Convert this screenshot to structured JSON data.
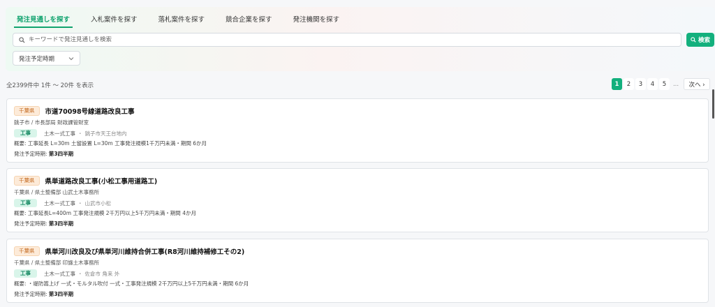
{
  "tabs": [
    {
      "label": "発注見通しを探す",
      "active": true
    },
    {
      "label": "入札案件を探す",
      "active": false
    },
    {
      "label": "落札案件を探す",
      "active": false
    },
    {
      "label": "競合企業を探す",
      "active": false
    },
    {
      "label": "発注機関を探す",
      "active": false
    }
  ],
  "search": {
    "placeholder": "キーワードで発注見通しを検索",
    "value": "",
    "button_label": "検索"
  },
  "filter": {
    "period_label": "発注予定時期"
  },
  "results": {
    "summary": "全2399件中 1件 〜 20件 を表示"
  },
  "pagination": {
    "pages": [
      "1",
      "2",
      "3",
      "4",
      "5"
    ],
    "current": "1",
    "ellipsis": "...",
    "next_label": "次へ ›"
  },
  "cards": [
    {
      "prefecture": "千葉県",
      "title": "市道70098号線道路改良工事",
      "org": "銚子市 / 市長部局 財政課管財室",
      "kind": "工事",
      "category": "土木一式工事",
      "location": "銚子市天王台地内",
      "summary": "概要: 工事延長 L=30m 土留設置 L=30m 工事発注規模1千万円未満・期間 6か月",
      "period_label": "発注予定時期:",
      "period_value": "第3四半期"
    },
    {
      "prefecture": "千葉県",
      "title": "県単道路改良工事(小松工事用道路工)",
      "org": "千葉県 / 県土整備部 山武土木事務所",
      "kind": "工事",
      "category": "土木一式工事",
      "location": "山武市小松",
      "summary": "概要: 工事延長L=400m 工事発注規模 2千万円以上5千万円未満・期間 4か月",
      "period_label": "発注予定時期:",
      "period_value": "第3四半期"
    },
    {
      "prefecture": "千葉県",
      "title": "県単河川改良及び県単河川維持合併工事(R8河川維持補修工その2)",
      "org": "千葉県 / 県土整備部 印旛土木事務所",
      "kind": "工事",
      "category": "土木一式工事",
      "location": "佐倉市 角来 外",
      "summary": "概要: ・堤防嵩上げ 一式・モルタル吹付 一式・工事発注規模 2千万円以上5千万円未満・期間 6か月",
      "period_label": "発注予定時期:",
      "period_value": "第3四半期"
    }
  ],
  "colors": {
    "accent": "#13b07d",
    "prefecture_badge": "#fdebd9",
    "kind_badge": "#d9f5ea"
  }
}
